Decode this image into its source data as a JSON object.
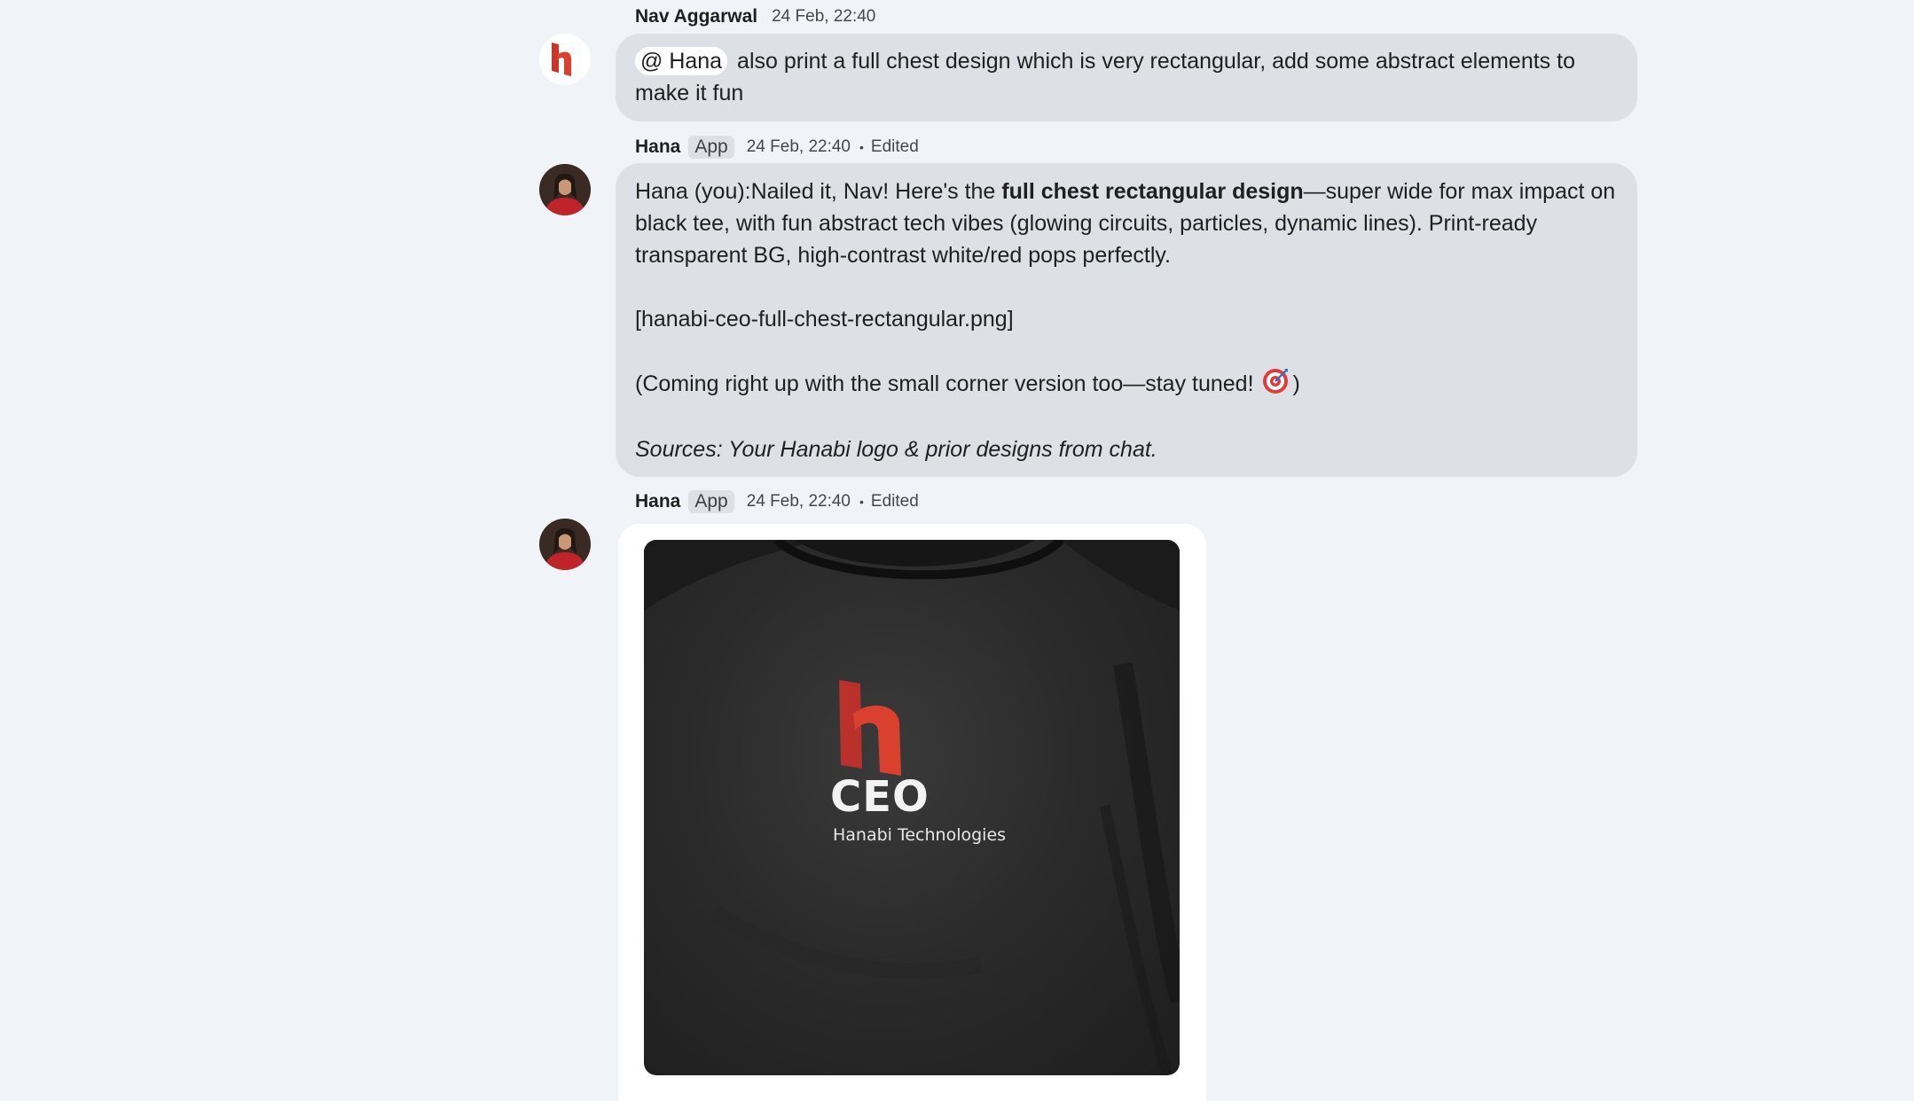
{
  "messages": [
    {
      "sender": "Nav Aggarwal",
      "timestamp": "24 Feb, 22:40",
      "avatar_icon": "hanabi-logo-icon",
      "mention": "@ Hana",
      "text": "also print a full chest design which is very rectangular, add some abstract elements to make it fun"
    },
    {
      "sender": "Hana",
      "badge": "App",
      "timestamp": "24 Feb, 22:40",
      "separator": "•",
      "status": "Edited",
      "avatar_icon": "person-avatar-icon",
      "line1_prefix": "Hana (you):Nailed it, Nav! Here's the ",
      "line1_bold": "full chest rectangular design",
      "line1_suffix": "—super wide for max impact on black tee, with fun abstract tech vibes (glowing circuits, particles, dynamic lines). Print-ready transparent BG, high-contrast white/red pops perfectly.",
      "file_ref": "[hanabi-ceo-full-chest-rectangular.png]",
      "follow_up_before": "(Coming right up with the small corner version too—stay tuned!",
      "follow_up_emoji": "target-emoji-icon",
      "follow_up_after": ")",
      "sources": "Sources: Your Hanabi logo & prior designs from chat."
    },
    {
      "sender": "Hana",
      "badge": "App",
      "timestamp": "24 Feb, 22:40",
      "separator": "•",
      "status": "Edited",
      "avatar_icon": "person-avatar-icon",
      "image": {
        "description_icon": "tshirt-mockup-image",
        "print_title": "CEO",
        "print_subtitle": "Hanabi Technologies"
      }
    }
  ],
  "colors": {
    "background": "#f0f4f9",
    "bubble": "#dde1e6",
    "brand_red": "#d9412e"
  }
}
